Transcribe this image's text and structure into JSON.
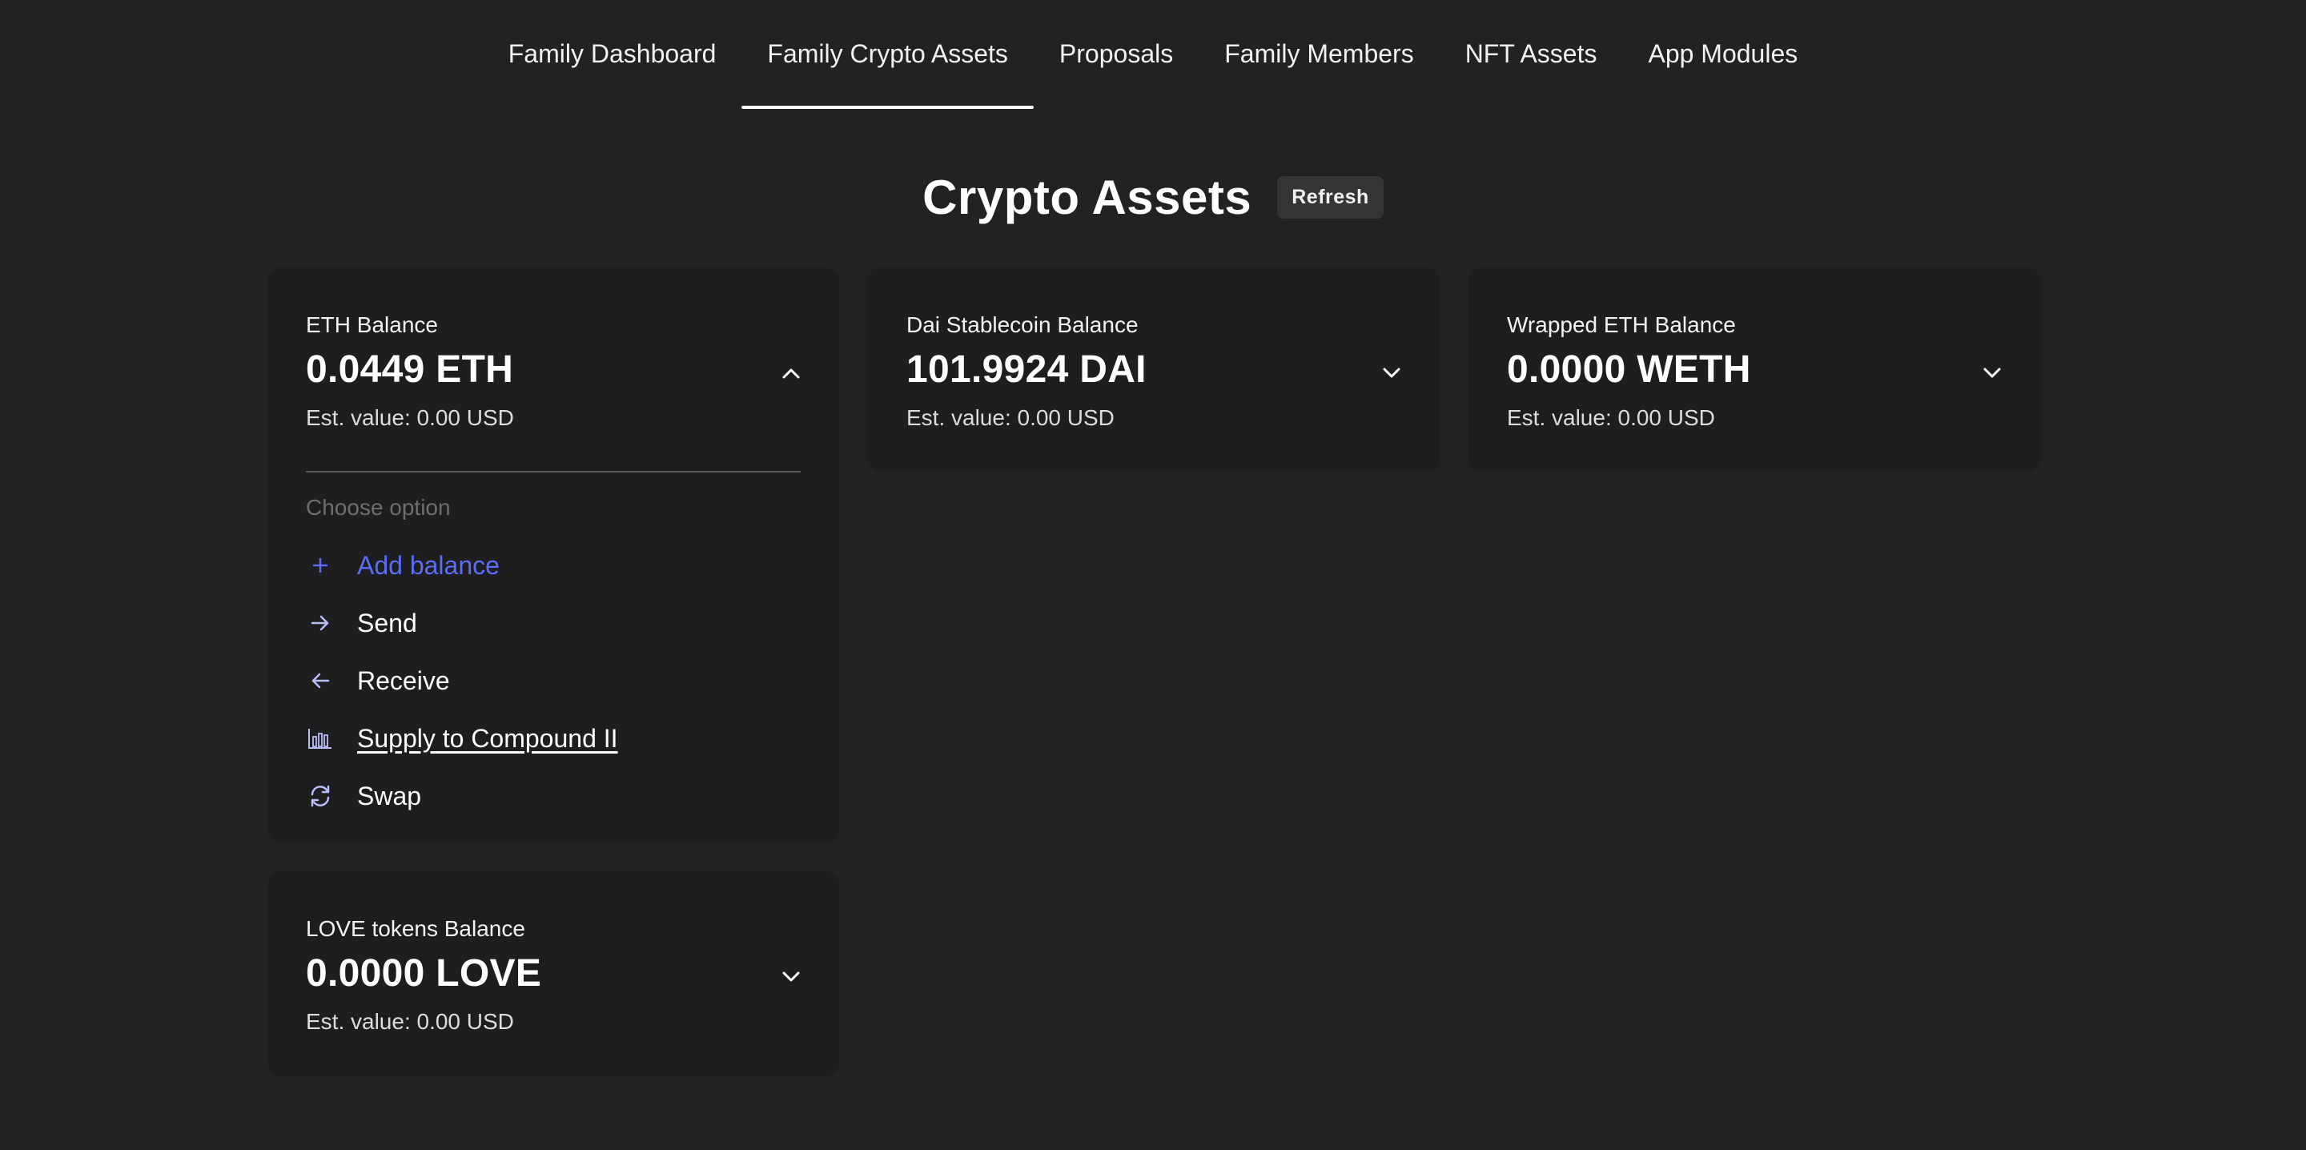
{
  "nav": {
    "tabs": [
      {
        "label": "Family Dashboard"
      },
      {
        "label": "Family Crypto Assets",
        "active": true
      },
      {
        "label": "Proposals"
      },
      {
        "label": "Family Members"
      },
      {
        "label": "NFT Assets"
      },
      {
        "label": "App Modules"
      }
    ]
  },
  "header": {
    "title": "Crypto Assets",
    "refresh_label": "Refresh"
  },
  "cards": [
    {
      "label": "ETH Balance",
      "amount": "0.0449 ETH",
      "est": "Est. value: 0.00 USD",
      "expanded": true,
      "menu": {
        "placeholder": "Choose option",
        "options": [
          {
            "label": "Add balance",
            "icon": "plus-icon"
          },
          {
            "label": "Send",
            "icon": "arrow-right-icon"
          },
          {
            "label": "Receive",
            "icon": "arrow-left-icon"
          },
          {
            "label": "Supply to Compound II",
            "icon": "bar-chart-icon"
          },
          {
            "label": "Swap",
            "icon": "swap-icon"
          }
        ]
      }
    },
    {
      "label": "Dai Stablecoin Balance",
      "amount": "101.9924 DAI",
      "est": "Est. value: 0.00 USD",
      "expanded": false
    },
    {
      "label": "Wrapped ETH Balance",
      "amount": "0.0000 WETH",
      "est": "Est. value: 0.00 USD",
      "expanded": false
    },
    {
      "label": "LOVE tokens Balance",
      "amount": "0.0000 LOVE",
      "est": "Est. value: 0.00 USD",
      "expanded": false
    }
  ],
  "colors": {
    "background": "#222222",
    "card": "#1e1e20",
    "accent_blue": "#5b6ef5",
    "icon_lavender": "#b9bdf5"
  }
}
